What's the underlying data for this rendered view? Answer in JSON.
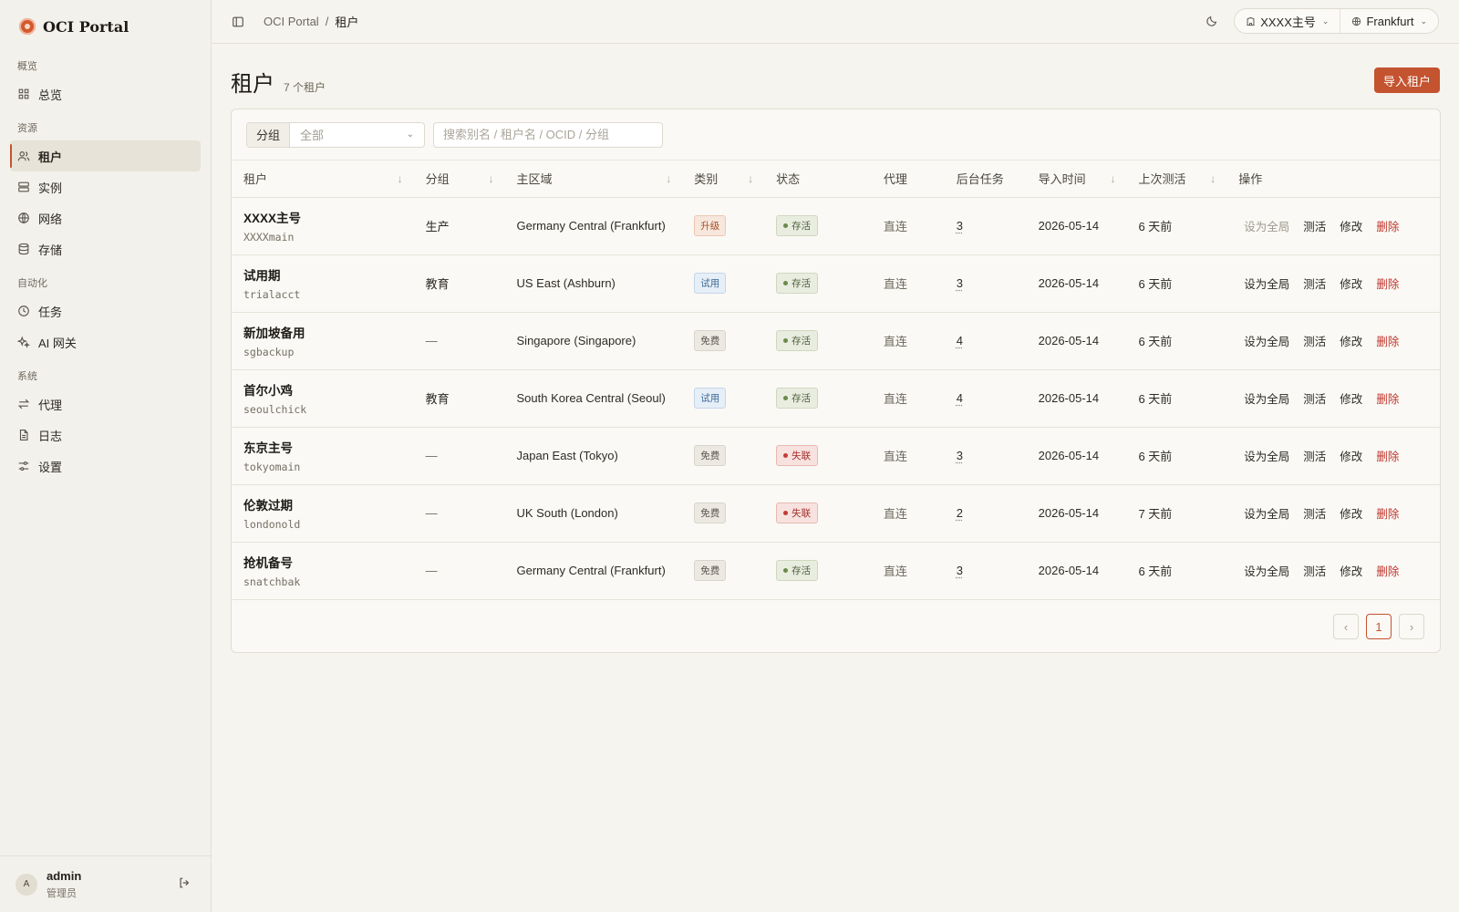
{
  "brand": {
    "title": "OCI Portal"
  },
  "sidebar": {
    "sections": [
      {
        "label": "概览",
        "items": [
          {
            "label": "总览",
            "icon": "grid-icon"
          }
        ]
      },
      {
        "label": "资源",
        "items": [
          {
            "label": "租户",
            "icon": "users-icon",
            "active": true
          },
          {
            "label": "实例",
            "icon": "server-icon"
          },
          {
            "label": "网络",
            "icon": "globe-icon"
          },
          {
            "label": "存储",
            "icon": "database-icon"
          }
        ]
      },
      {
        "label": "自动化",
        "items": [
          {
            "label": "任务",
            "icon": "clock-icon"
          },
          {
            "label": "AI 网关",
            "icon": "sparkle-icon"
          }
        ]
      },
      {
        "label": "系统",
        "items": [
          {
            "label": "代理",
            "icon": "arrows-icon"
          },
          {
            "label": "日志",
            "icon": "file-icon"
          },
          {
            "label": "设置",
            "icon": "sliders-icon"
          }
        ]
      }
    ],
    "user": {
      "initial": "A",
      "name": "admin",
      "role": "管理员"
    }
  },
  "topbar": {
    "breadcrumb": {
      "root": "OCI Portal",
      "sep": "/",
      "current": "租户"
    },
    "tenant_switch": "XXXX主号",
    "region_switch": "Frankfurt"
  },
  "page": {
    "title": "租户",
    "count": "7 个租户",
    "import_label": "导入租户"
  },
  "filter": {
    "group_label": "分组",
    "group_value": "全部",
    "search_placeholder": "搜索别名 / 租户名 / OCID / 分组"
  },
  "table": {
    "columns": [
      "租户",
      "分组",
      "主区域",
      "类别",
      "状态",
      "代理",
      "后台任务",
      "导入时间",
      "上次测活",
      "操作"
    ],
    "rows": [
      {
        "name": "XXXX主号",
        "sub": "XXXXmain",
        "group": "生产",
        "region": "Germany Central (Frankfurt)",
        "type": "升级",
        "type_kind": "upgrade",
        "status": "存活",
        "status_kind": "alive",
        "proxy": "直连",
        "tasks": "3",
        "imported": "2026-05-14",
        "last_check": "6 天前",
        "set_global_disabled": true
      },
      {
        "name": "试用期",
        "sub": "trialacct",
        "group": "教育",
        "region": "US East (Ashburn)",
        "type": "试用",
        "type_kind": "trial",
        "status": "存活",
        "status_kind": "alive",
        "proxy": "直连",
        "tasks": "3",
        "imported": "2026-05-14",
        "last_check": "6 天前",
        "set_global_disabled": false
      },
      {
        "name": "新加坡备用",
        "sub": "sgbackup",
        "group": "—",
        "region": "Singapore (Singapore)",
        "type": "免费",
        "type_kind": "free",
        "status": "存活",
        "status_kind": "alive",
        "proxy": "直连",
        "tasks": "4",
        "imported": "2026-05-14",
        "last_check": "6 天前",
        "set_global_disabled": false
      },
      {
        "name": "首尔小鸡",
        "sub": "seoulchick",
        "group": "教育",
        "region": "South Korea Central (Seoul)",
        "type": "试用",
        "type_kind": "trial",
        "status": "存活",
        "status_kind": "alive",
        "proxy": "直连",
        "tasks": "4",
        "imported": "2026-05-14",
        "last_check": "6 天前",
        "set_global_disabled": false
      },
      {
        "name": "东京主号",
        "sub": "tokyomain",
        "group": "—",
        "region": "Japan East (Tokyo)",
        "type": "免费",
        "type_kind": "free",
        "status": "失联",
        "status_kind": "lost",
        "proxy": "直连",
        "tasks": "3",
        "imported": "2026-05-14",
        "last_check": "6 天前",
        "set_global_disabled": false
      },
      {
        "name": "伦敦过期",
        "sub": "londonold",
        "group": "—",
        "region": "UK South (London)",
        "type": "免费",
        "type_kind": "free",
        "status": "失联",
        "status_kind": "lost",
        "proxy": "直连",
        "tasks": "2",
        "imported": "2026-05-14",
        "last_check": "7 天前",
        "set_global_disabled": false
      },
      {
        "name": "抢机备号",
        "sub": "snatchbak",
        "group": "—",
        "region": "Germany Central (Frankfurt)",
        "type": "免费",
        "type_kind": "free",
        "status": "存活",
        "status_kind": "alive",
        "proxy": "直连",
        "tasks": "3",
        "imported": "2026-05-14",
        "last_check": "6 天前",
        "set_global_disabled": false
      }
    ],
    "actions": {
      "set_global": "设为全局",
      "test": "测活",
      "edit": "修改",
      "delete": "删除"
    }
  },
  "pagination": {
    "current": "1"
  },
  "colors": {
    "accent": "#c4532f",
    "danger": "#c1362e",
    "alive": "#6a8a4b",
    "lost": "#c33b35"
  }
}
